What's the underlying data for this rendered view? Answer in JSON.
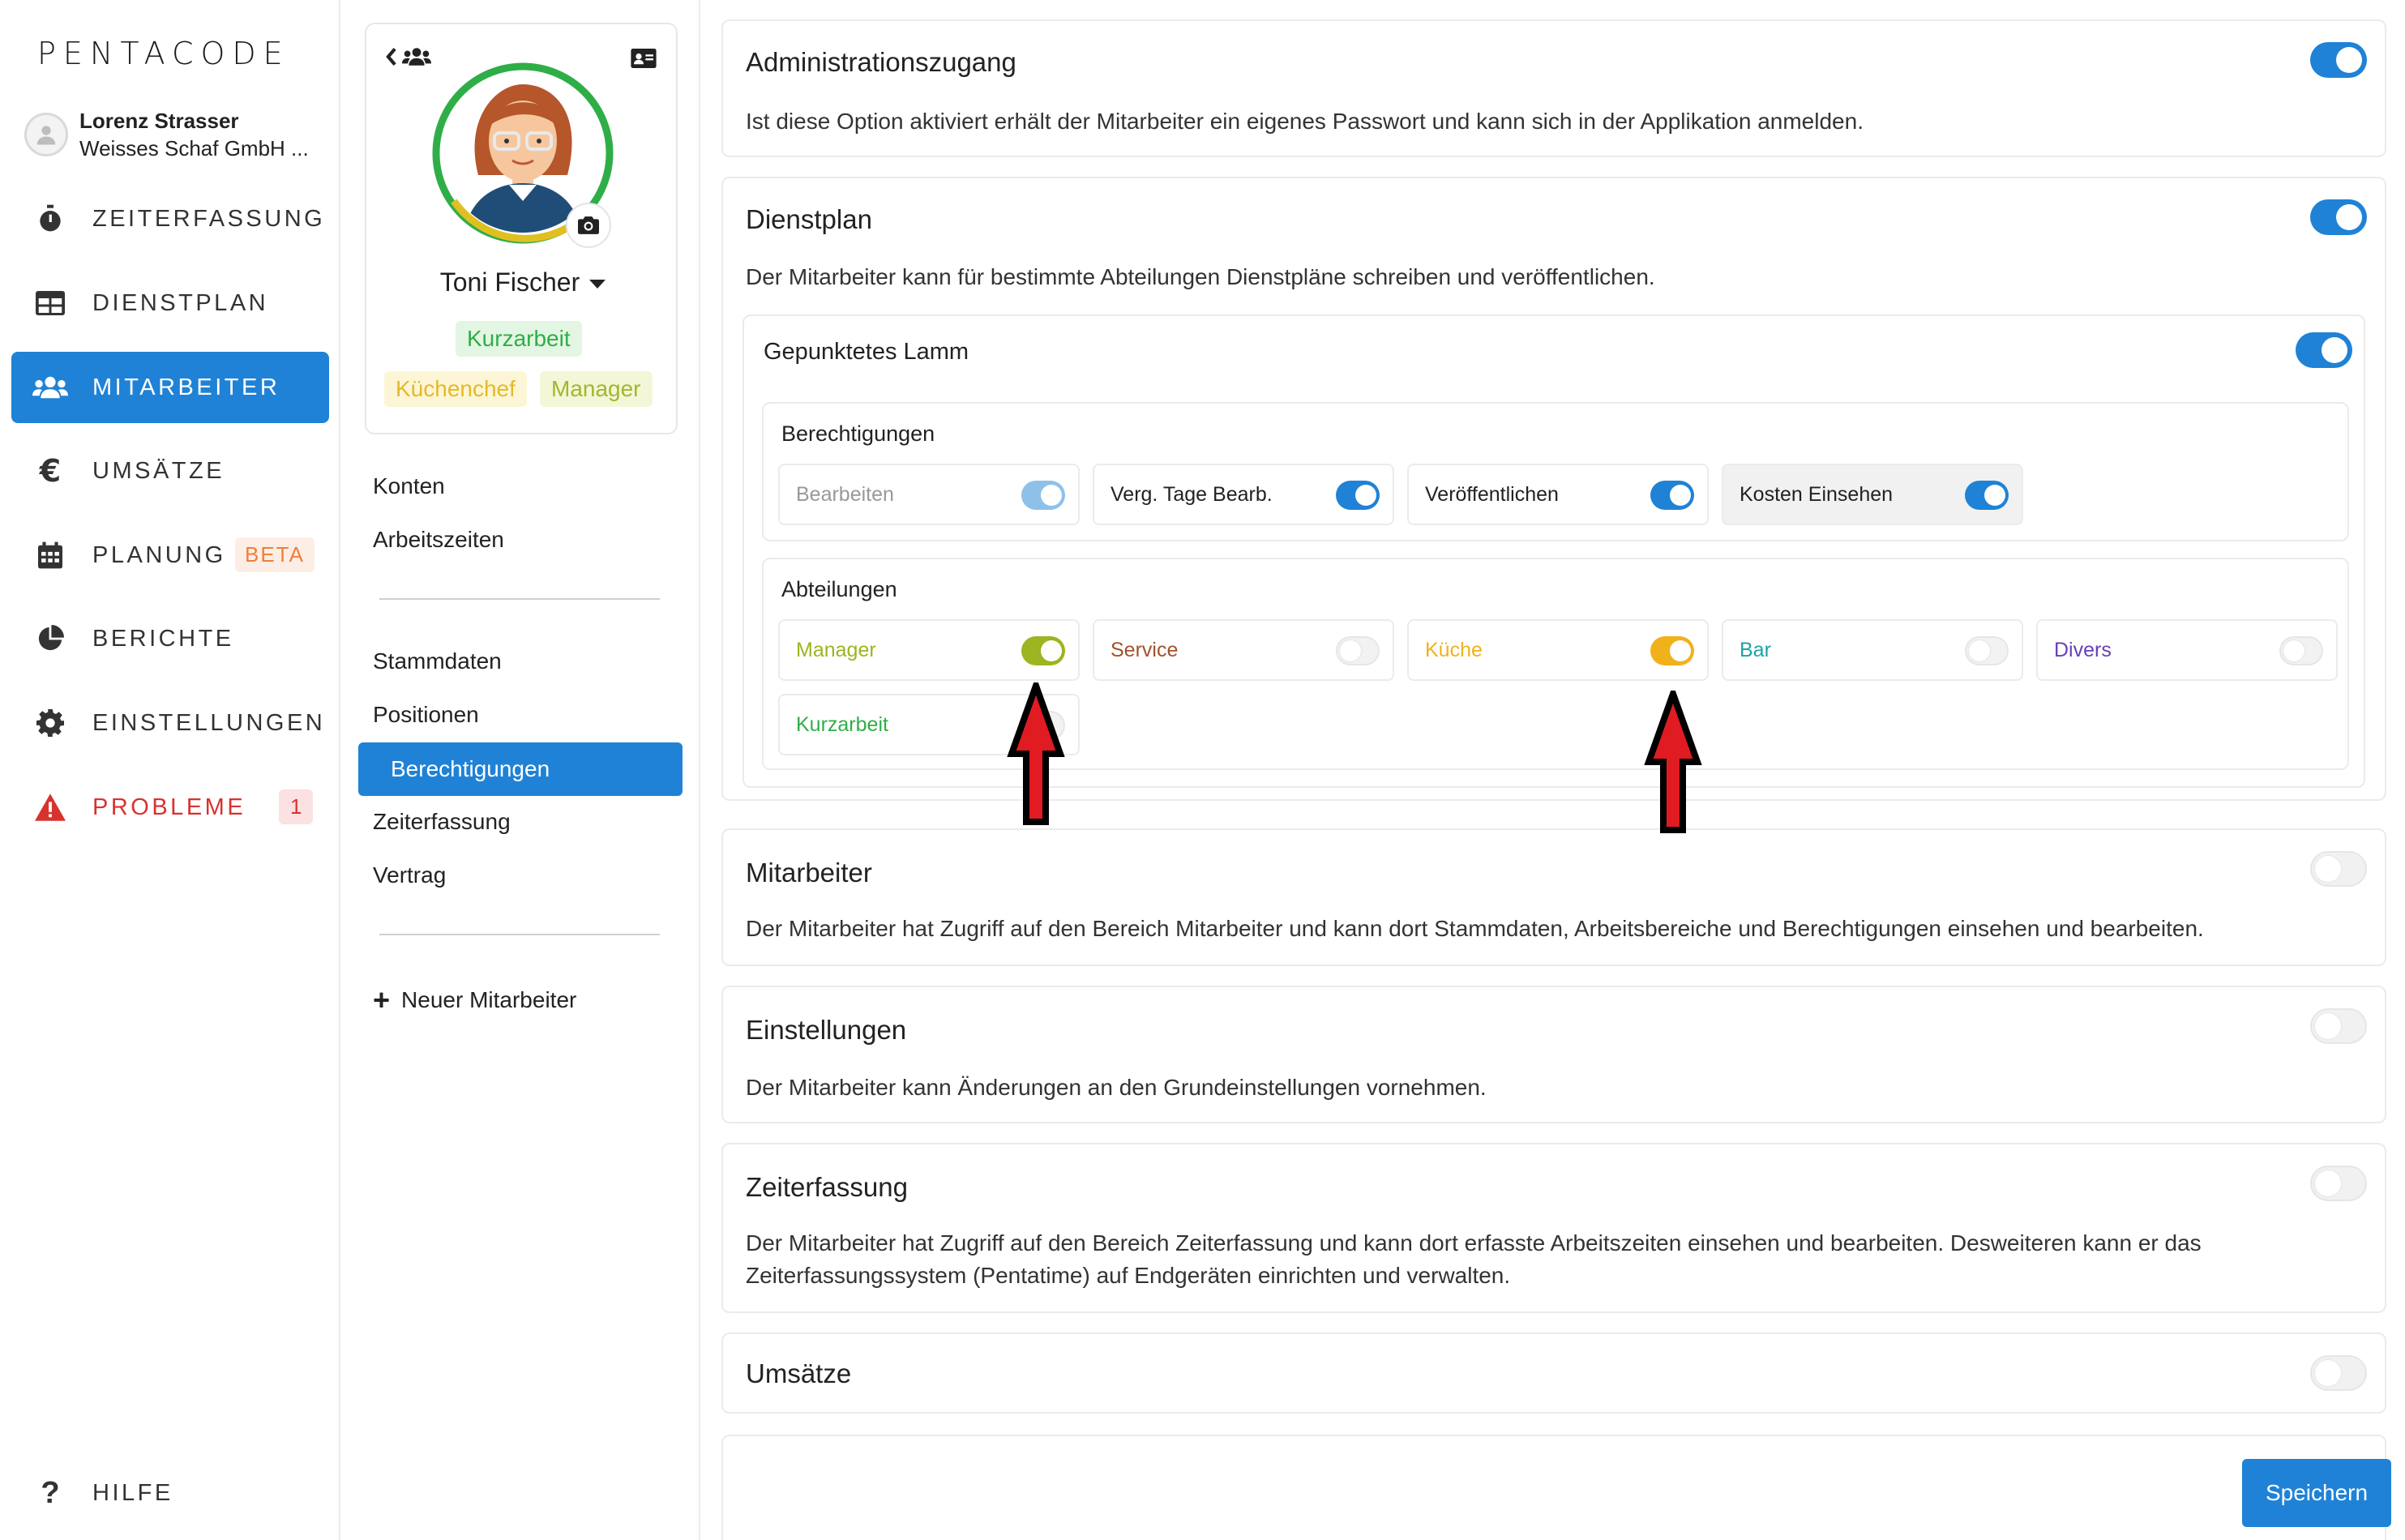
{
  "app": {
    "logo": "PENTACODE",
    "user_name": "Lorenz Strasser",
    "user_company": "Weisses Schaf GmbH ..."
  },
  "nav": {
    "items": [
      {
        "label": "ZEITERFASSUNG",
        "icon": "stopwatch-icon"
      },
      {
        "label": "DIENSTPLAN",
        "icon": "table-icon"
      },
      {
        "label": "MITARBEITER",
        "icon": "users-icon",
        "active": true
      },
      {
        "label": "UMSÄTZE",
        "icon": "euro-icon"
      },
      {
        "label": "PLANUNG",
        "icon": "calendar-icon",
        "badge": "BETA"
      },
      {
        "label": "BERICHTE",
        "icon": "pie-chart-icon"
      },
      {
        "label": "EINSTELLUNGEN",
        "icon": "gear-icon"
      },
      {
        "label": "PROBLEME",
        "icon": "warning-icon",
        "badge": "1"
      }
    ],
    "help": "HILFE"
  },
  "profile": {
    "name": "Toni Fischer",
    "tags": [
      "Kurzarbeit",
      "Küchenchef",
      "Manager"
    ],
    "links_group1": [
      "Konten",
      "Arbeitszeiten"
    ],
    "links_group2": [
      "Stammdaten",
      "Positionen",
      "Berechtigungen",
      "Zeiterfassung",
      "Vertrag"
    ],
    "active_link": "Berechtigungen",
    "new_employee": "Neuer Mitarbeiter"
  },
  "sections": {
    "admin": {
      "title": "Administrationszugang",
      "desc": "Ist diese Option aktiviert erhält der Mitarbeiter ein eigenes Passwort und kann sich in der Applikation anmelden.",
      "enabled": true
    },
    "dienstplan": {
      "title": "Dienstplan",
      "desc": "Der Mitarbeiter kann für bestimmte Abteilungen Dienstpläne schreiben und veröffentlichen.",
      "enabled": true,
      "location": {
        "name": "Gepunktetes Lamm",
        "enabled": true,
        "permissions_title": "Berechtigungen",
        "permissions": [
          {
            "label": "Bearbeiten",
            "on": true,
            "disabled": true
          },
          {
            "label": "Verg. Tage Bearb.",
            "on": true
          },
          {
            "label": "Veröffentlichen",
            "on": true
          },
          {
            "label": "Kosten Einsehen",
            "on": true,
            "shaded": true
          }
        ],
        "departments_title": "Abteilungen",
        "departments": [
          {
            "label": "Manager",
            "on": true,
            "color": "#9cb520"
          },
          {
            "label": "Service",
            "on": false,
            "color": "#a0522d"
          },
          {
            "label": "Küche",
            "on": true,
            "color": "#f0b21b"
          },
          {
            "label": "Bar",
            "on": false,
            "color": "#1aa3a8"
          },
          {
            "label": "Divers",
            "on": false,
            "color": "#6a3fb8"
          },
          {
            "label": "Kurzarbeit",
            "on": false,
            "color": "#2fae47"
          }
        ]
      }
    },
    "mitarbeiter": {
      "title": "Mitarbeiter",
      "desc": "Der Mitarbeiter hat Zugriff auf den Bereich Mitarbeiter und kann dort Stammdaten, Arbeitsbereiche und Berechtigungen einsehen und bearbeiten.",
      "enabled": false
    },
    "einstellungen": {
      "title": "Einstellungen",
      "desc": "Der Mitarbeiter kann Änderungen an den Grundeinstellungen vornehmen.",
      "enabled": false
    },
    "zeiterfassung": {
      "title": "Zeiterfassung",
      "desc_line1": "Der Mitarbeiter hat Zugriff auf den Bereich Zeiterfassung und kann dort erfasste Arbeitszeiten einsehen und bearbeiten. Desweiteren kann er das",
      "desc_line2": "Zeiterfassungssystem (Pentatime) auf Endgeräten einrichten und verwalten.",
      "enabled": false
    },
    "umsaetze": {
      "title": "Umsätze",
      "enabled": false
    }
  },
  "save_label": "Speichern",
  "colors": {
    "accent": "#1f82d6",
    "danger": "#d8322f"
  }
}
